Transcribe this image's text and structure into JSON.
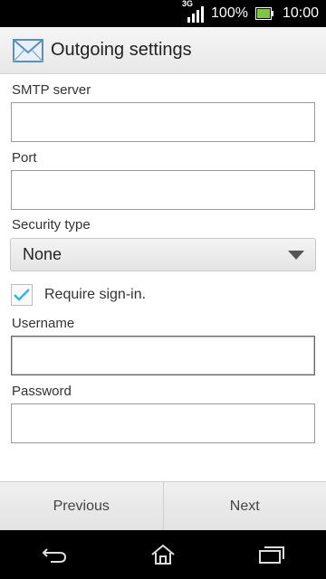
{
  "status_bar": {
    "network_type": "3G",
    "battery_percent": "100%",
    "time": "10:00",
    "icons": [
      "signal-icon",
      "battery-icon"
    ]
  },
  "header": {
    "title": "Outgoing settings",
    "icon": "mail-icon"
  },
  "form": {
    "smtp_label": "SMTP server",
    "smtp_value": "",
    "port_label": "Port",
    "port_value": "",
    "security_label": "Security type",
    "security_value": "None",
    "require_signin_label": "Require sign-in.",
    "require_signin_checked": true,
    "username_label": "Username",
    "username_value": "",
    "password_label": "Password",
    "password_value": ""
  },
  "buttons": {
    "previous": "Previous",
    "next": "Next"
  },
  "nav": {
    "icons": [
      "back-icon",
      "home-icon",
      "recent-apps-icon"
    ]
  },
  "colors": {
    "accent": "#33b5e5",
    "status_bar": "#000000",
    "battery": "#7ac943"
  }
}
